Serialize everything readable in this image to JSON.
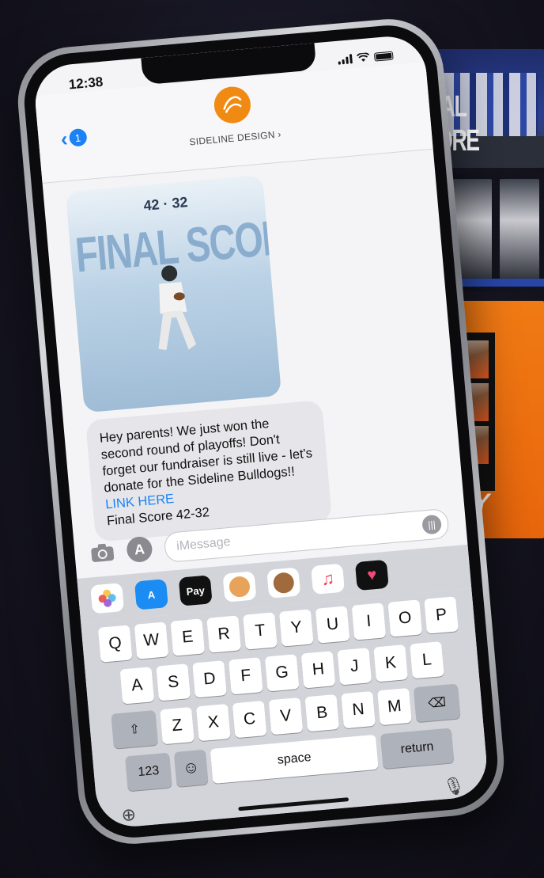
{
  "status_bar": {
    "time": "12:38"
  },
  "header": {
    "back_badge": "1",
    "contact_name": "SIDELINE DESIGN"
  },
  "message_image": {
    "score": "42 · 32",
    "headline": "FINAL SCORE"
  },
  "message": {
    "text": "Hey parents! We just won the second round of playoffs! Don't forget our fundraiser is still live - let's donate for the Sideline Bulldogs!!",
    "link": "LINK HERE",
    "score_line": "Final Score 42-32"
  },
  "composer": {
    "placeholder": "iMessage"
  },
  "app_drawer": [
    "photos",
    "app-store",
    "apple-pay",
    "memoji",
    "animoji",
    "music",
    "digital-touch"
  ],
  "apple_pay_label": "Pay",
  "keyboard": {
    "row1": [
      "Q",
      "W",
      "E",
      "R",
      "T",
      "Y",
      "U",
      "I",
      "O",
      "P"
    ],
    "row2": [
      "A",
      "S",
      "D",
      "F",
      "G",
      "H",
      "J",
      "K",
      "L"
    ],
    "row3": [
      "Z",
      "X",
      "C",
      "V",
      "B",
      "N",
      "M"
    ],
    "numbers_label": "123",
    "space_label": "space",
    "return_label": "return"
  },
  "background_panels": {
    "top_title": "FINAL SCORE",
    "bottom_title": "DAY"
  },
  "colors": {
    "accent": "#1a82f5",
    "brand": "#f08a12",
    "bubble": "#e6e6ea"
  }
}
